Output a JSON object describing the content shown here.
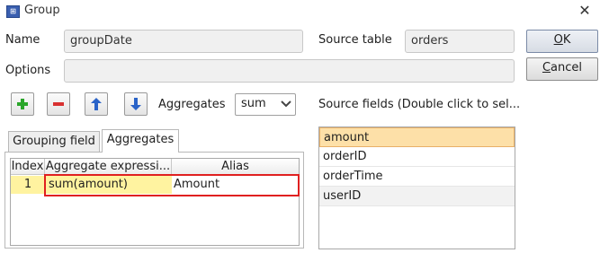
{
  "window": {
    "title": "Group",
    "app_icon": "grid-app-icon",
    "close_glyph": "✕"
  },
  "form": {
    "name_label": "Name",
    "name_value": "groupDate",
    "source_table_label": "Source table",
    "source_table_value": "orders",
    "options_label": "Options",
    "options_value": ""
  },
  "buttons": {
    "ok_mnemonic": "O",
    "ok_rest": "K",
    "cancel_mnemonic": "C",
    "cancel_rest": "ancel"
  },
  "toolbar": {
    "add_icon": "plus-icon",
    "remove_icon": "minus-icon",
    "up_icon": "arrow-up-icon",
    "down_icon": "arrow-down-icon",
    "aggregates_label": "Aggregates",
    "aggregates_selected": "sum",
    "source_fields_label": "Source fields (Double click to sel..."
  },
  "tabs": [
    {
      "label": "Grouping field",
      "active": false
    },
    {
      "label": "Aggregates",
      "active": true
    }
  ],
  "table": {
    "headers": [
      "Index",
      "Aggregate expressi...",
      "Alias"
    ],
    "rows": [
      {
        "index": "1",
        "expression": "sum(amount)",
        "alias": "Amount"
      }
    ]
  },
  "source_fields": [
    "amount",
    "orderID",
    "orderTime",
    "userID"
  ],
  "colors": {
    "selection": "#fde0a8",
    "row_highlight": "#fff3a0",
    "annotation_border": "#e02020",
    "plus_green": "#2aa62a",
    "minus_red": "#d83030",
    "arrow_blue": "#2a63c8"
  }
}
